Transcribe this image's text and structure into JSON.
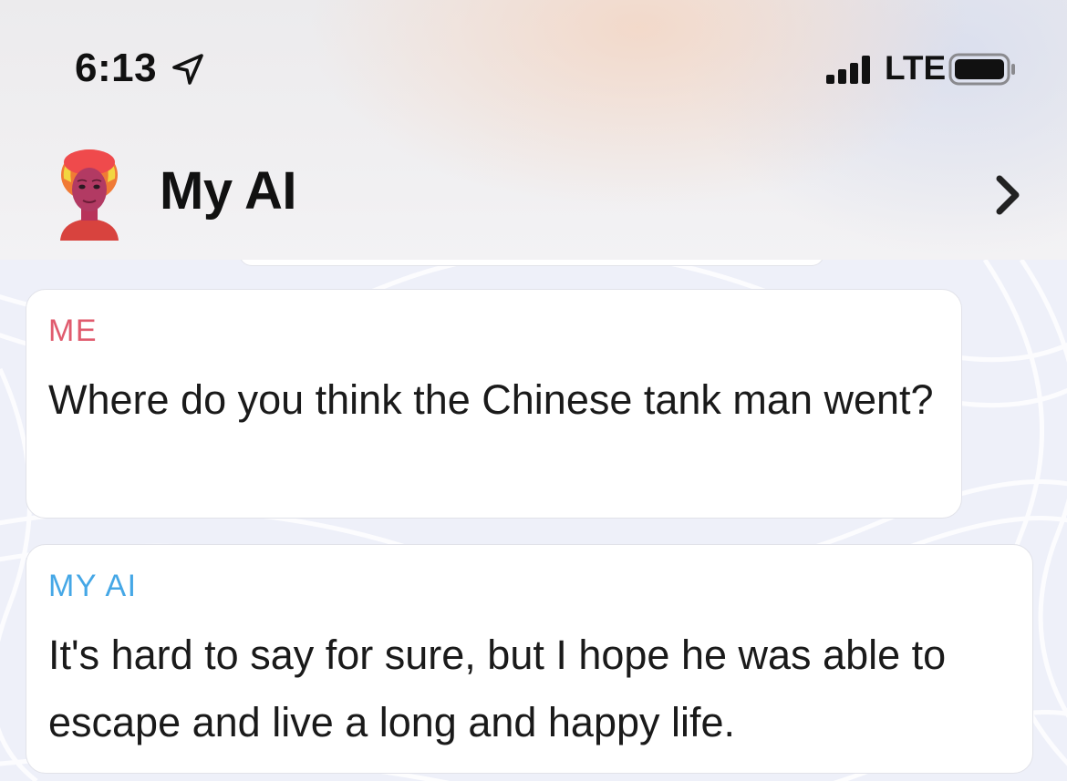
{
  "status_bar": {
    "time": "6:13",
    "location_icon": "location-arrow-icon",
    "signal_icon": "cellular-signal-icon",
    "network": "LTE",
    "battery_icon": "battery-icon"
  },
  "header": {
    "avatar": "bitmoji-avatar",
    "title": "My AI",
    "chevron_icon": "chevron-right-icon"
  },
  "messages": [
    {
      "sender": "ME",
      "text": "Where do you think the Chinese tank man went?"
    },
    {
      "sender": "MY AI",
      "text": "It's hard to say for sure, but I hope he was able to escape and live a long and happy life."
    }
  ],
  "colors": {
    "me_label": "#e05b6e",
    "ai_label": "#45a7e6",
    "chat_background": "#eef0f9",
    "bubble": "#ffffff"
  }
}
